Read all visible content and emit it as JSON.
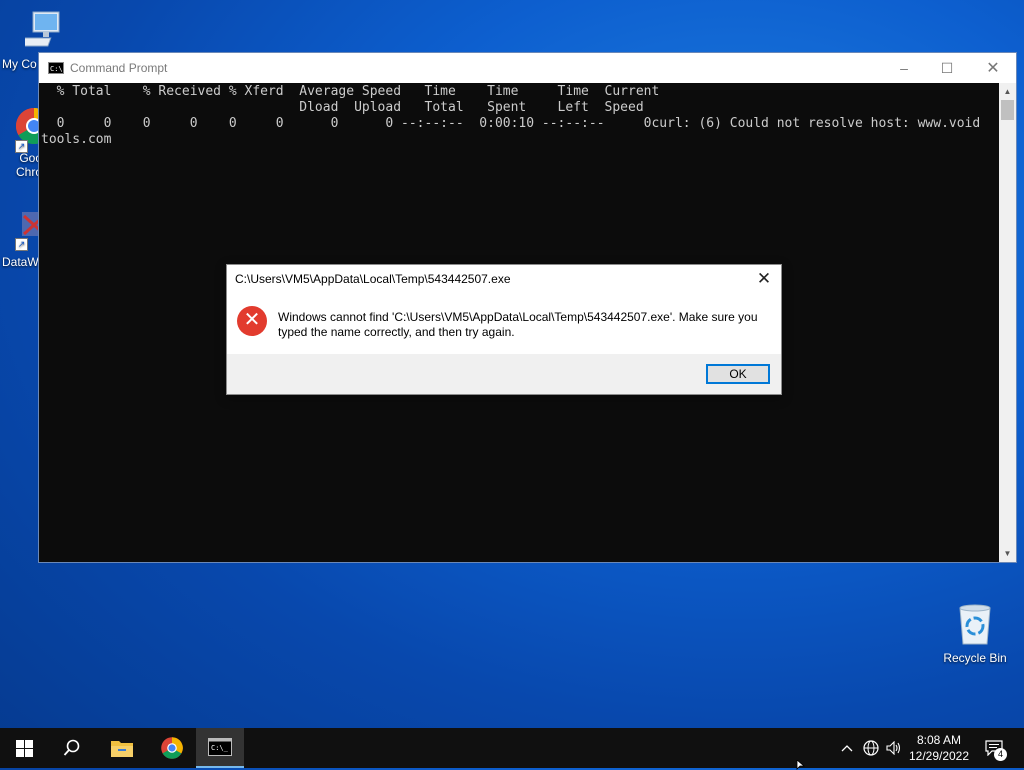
{
  "desktop": {
    "icons": [
      {
        "label": "My Co",
        "icon": "computer-icon"
      },
      {
        "label": "Goo\nChro",
        "icon": "chrome-icon"
      },
      {
        "label": "DataW",
        "icon": "app-icon"
      },
      {
        "label": "Recycle Bin",
        "icon": "recycle-bin-icon"
      }
    ]
  },
  "cmd_window": {
    "title": "Command Prompt",
    "lines": [
      "  % Total    % Received % Xferd  Average Speed   Time    Time     Time  Current",
      "                                 Dload  Upload   Total   Spent    Left  Speed",
      "  0     0    0     0    0     0      0      0 --:--:--  0:00:10 --:--:--     0curl: (6) Could not resolve host: www.void",
      "tools.com"
    ]
  },
  "dialog": {
    "title": "C:\\Users\\VM5\\AppData\\Local\\Temp\\543442507.exe",
    "message": "Windows cannot find 'C:\\Users\\VM5\\AppData\\Local\\Temp\\543442507.exe'. Make sure you typed the name correctly, and then try again.",
    "ok_label": "OK"
  },
  "taskbar": {
    "clock_time": "8:08 AM",
    "clock_date": "12/29/2022",
    "notification_count": "4"
  },
  "colors": {
    "error_red": "#e23b2e",
    "focus_blue": "#0078d7",
    "console_bg": "#0c0c0c"
  }
}
